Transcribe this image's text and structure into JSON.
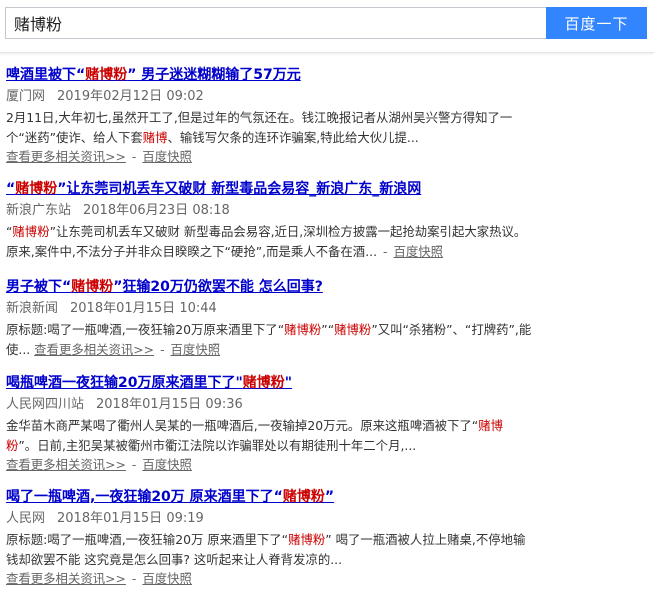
{
  "search": {
    "query": "赌博粉",
    "button_label": "百度一下"
  },
  "results": [
    {
      "title_pre": "啤酒里被下“",
      "title_hl": "赌博粉",
      "title_post": "” 男子迷迷糊糊输了57万元",
      "source": "厦门网",
      "date": "2019年02月12日",
      "time": "09:02",
      "line1": "2月11日,大年初七,虽然开工了,但是过年的气氛还在。钱江晚报记者从湖州吴兴警方得知了一",
      "line2_a": "个“迷药”使诈、给人下套",
      "line2_hl": "赌博",
      "line2_b": "、输钱写欠条的连环诈骗案,特此给大伙儿提...",
      "more_label": "查看更多相关资讯>>",
      "dash": "-",
      "snapshot_label": "百度快照"
    },
    {
      "title_pre": "“",
      "title_hl": "赌博粉",
      "title_post": "”让东莞司机丢车又破财 新型毒品会易容_新浪广东_新浪网",
      "source": "新浪广东站",
      "date": "2018年06月23日",
      "time": "08:18",
      "line1_a": "“",
      "line1_hl": "赌博粉",
      "line1_b": "”让东莞司机丢车又破财 新型毒品会易容,近日,深圳检方披露一起抢劫案引起大家热议。",
      "line2": "原来,案件中,不法分子并非众目睽睽之下“硬抢”,而是乘人不备在酒...",
      "dash": "-",
      "snapshot_label": "百度快照"
    },
    {
      "title_pre": "男子被下“",
      "title_hl": "赌博粉",
      "title_post": "”狂输20万仍欲罢不能 怎么回事?",
      "source": "新浪新闻",
      "date": "2018年01月15日",
      "time": "10:44",
      "line1_a": "原标题:喝了一瓶啤酒,一夜狂输20万原来酒里下了“",
      "line1_hl1": "赌博粉",
      "line1_b": "”“",
      "line1_hl2": "赌博粉",
      "line1_c": "”又叫“杀猪粉”、“打牌药”,能",
      "line2": "使...",
      "more_label": "查看更多相关资讯>>",
      "dash": "-",
      "snapshot_label": "百度快照"
    },
    {
      "title_pre": "喝瓶啤酒一夜狂输20万原来酒里下了\"",
      "title_hl": "赌博粉",
      "title_post": "\"",
      "source": "人民网四川站",
      "date": "2018年01月15日",
      "time": "09:36",
      "line1_a": "金华苗木商严某喝了衢州人吴某的一瓶啤酒后,一夜输掉20万元。原来这瓶啤酒被下了“",
      "line1_hl": "赌博",
      "line2_a": "粉",
      "line2_b": "”。日前,主犯吴某被衢州市衢江法院以诈骗罪处以有期徒刑十年二个月,...",
      "more_label": "查看更多相关资讯>>",
      "dash": "-",
      "snapshot_label": "百度快照"
    },
    {
      "title_pre": "喝了一瓶啤酒,一夜狂输20万 原来酒里下了“",
      "title_hl": "赌博粉",
      "title_post": "”",
      "source": "人民网",
      "date": "2018年01月15日",
      "time": "09:19",
      "line1_a": "原标题:喝了一瓶啤酒,一夜狂输20万 原来酒里下了“",
      "line1_hl": "赌博粉",
      "line1_b": "” 喝了一瓶酒被人拉上赌桌,不停地输",
      "line2": "钱却欲罢不能 这究竟是怎么回事? 这听起来让人脊背发凉的...",
      "more_label": "查看更多相关资讯>>",
      "dash": "-",
      "snapshot_label": "百度快照"
    }
  ]
}
